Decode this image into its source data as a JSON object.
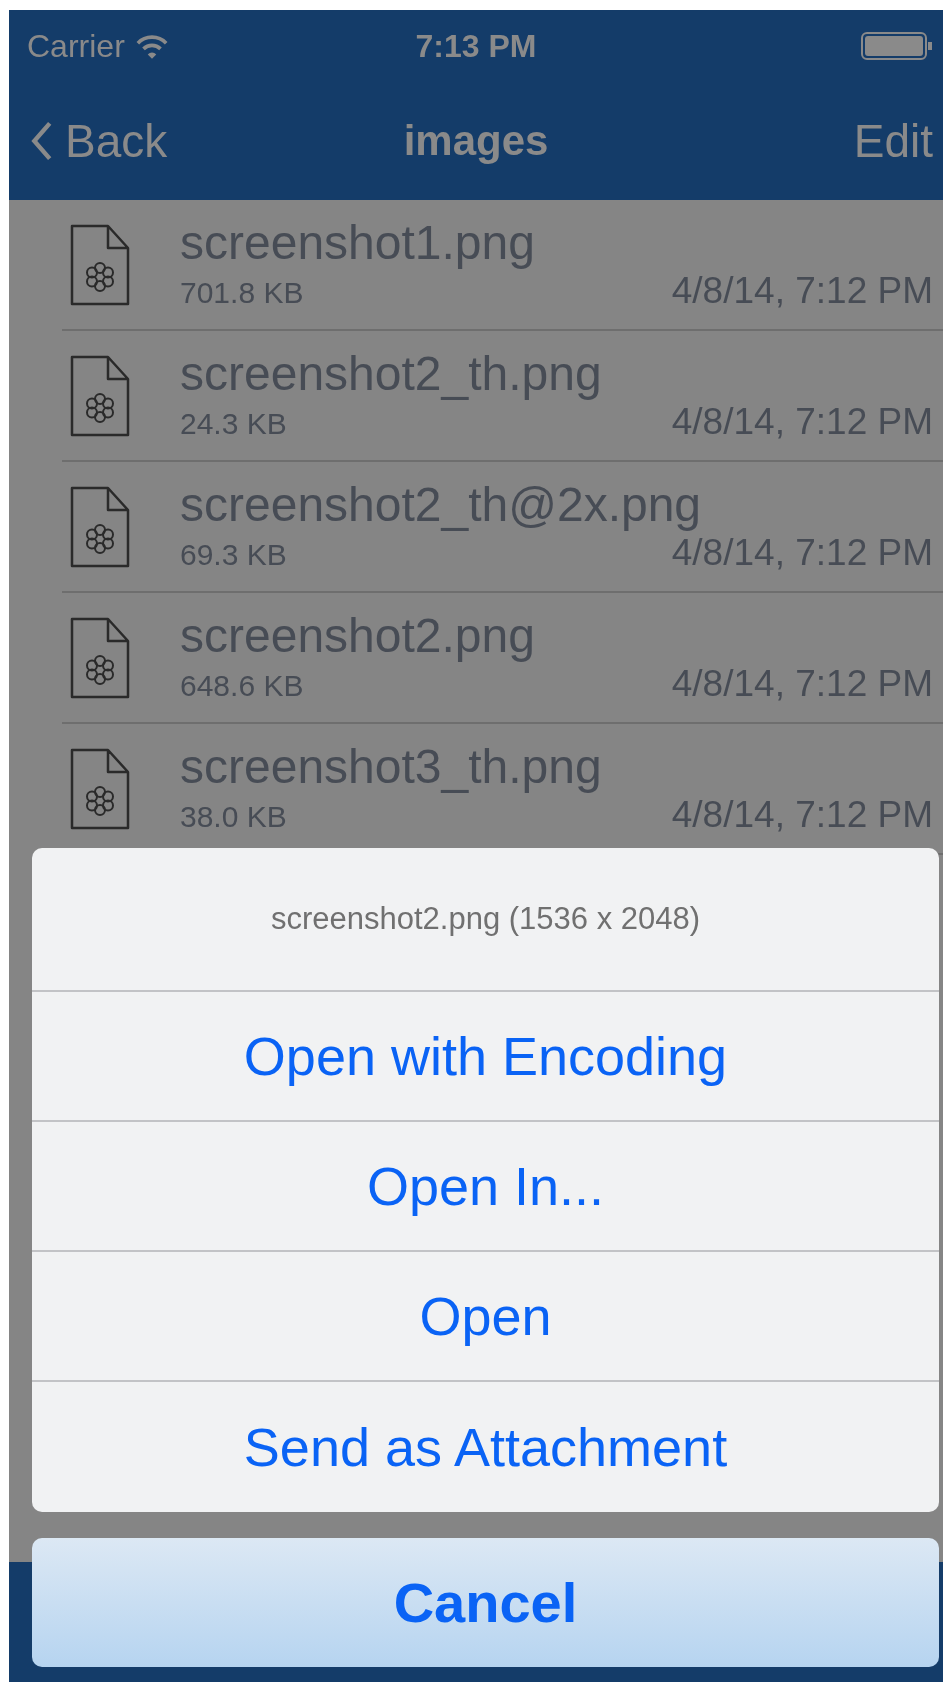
{
  "status_bar": {
    "carrier": "Carrier",
    "time": "7:13 PM"
  },
  "nav_bar": {
    "back": "Back",
    "title": "images",
    "edit": "Edit"
  },
  "files": [
    {
      "name": "screenshot1.png",
      "size": "701.8 KB",
      "date": "4/8/14, 7:12 PM"
    },
    {
      "name": "screenshot2_th.png",
      "size": "24.3 KB",
      "date": "4/8/14, 7:12 PM"
    },
    {
      "name": "screenshot2_th@2x.png",
      "size": "69.3 KB",
      "date": "4/8/14, 7:12 PM"
    },
    {
      "name": "screenshot2.png",
      "size": "648.6 KB",
      "date": "4/8/14, 7:12 PM"
    },
    {
      "name": "screenshot3_th.png",
      "size": "38.0 KB",
      "date": "4/8/14, 7:12 PM"
    }
  ],
  "action_sheet": {
    "title": "screenshot2.png (1536 x 2048)",
    "options": [
      "Open with Encoding",
      "Open In...",
      "Open",
      "Send as Attachment"
    ],
    "cancel": "Cancel"
  }
}
